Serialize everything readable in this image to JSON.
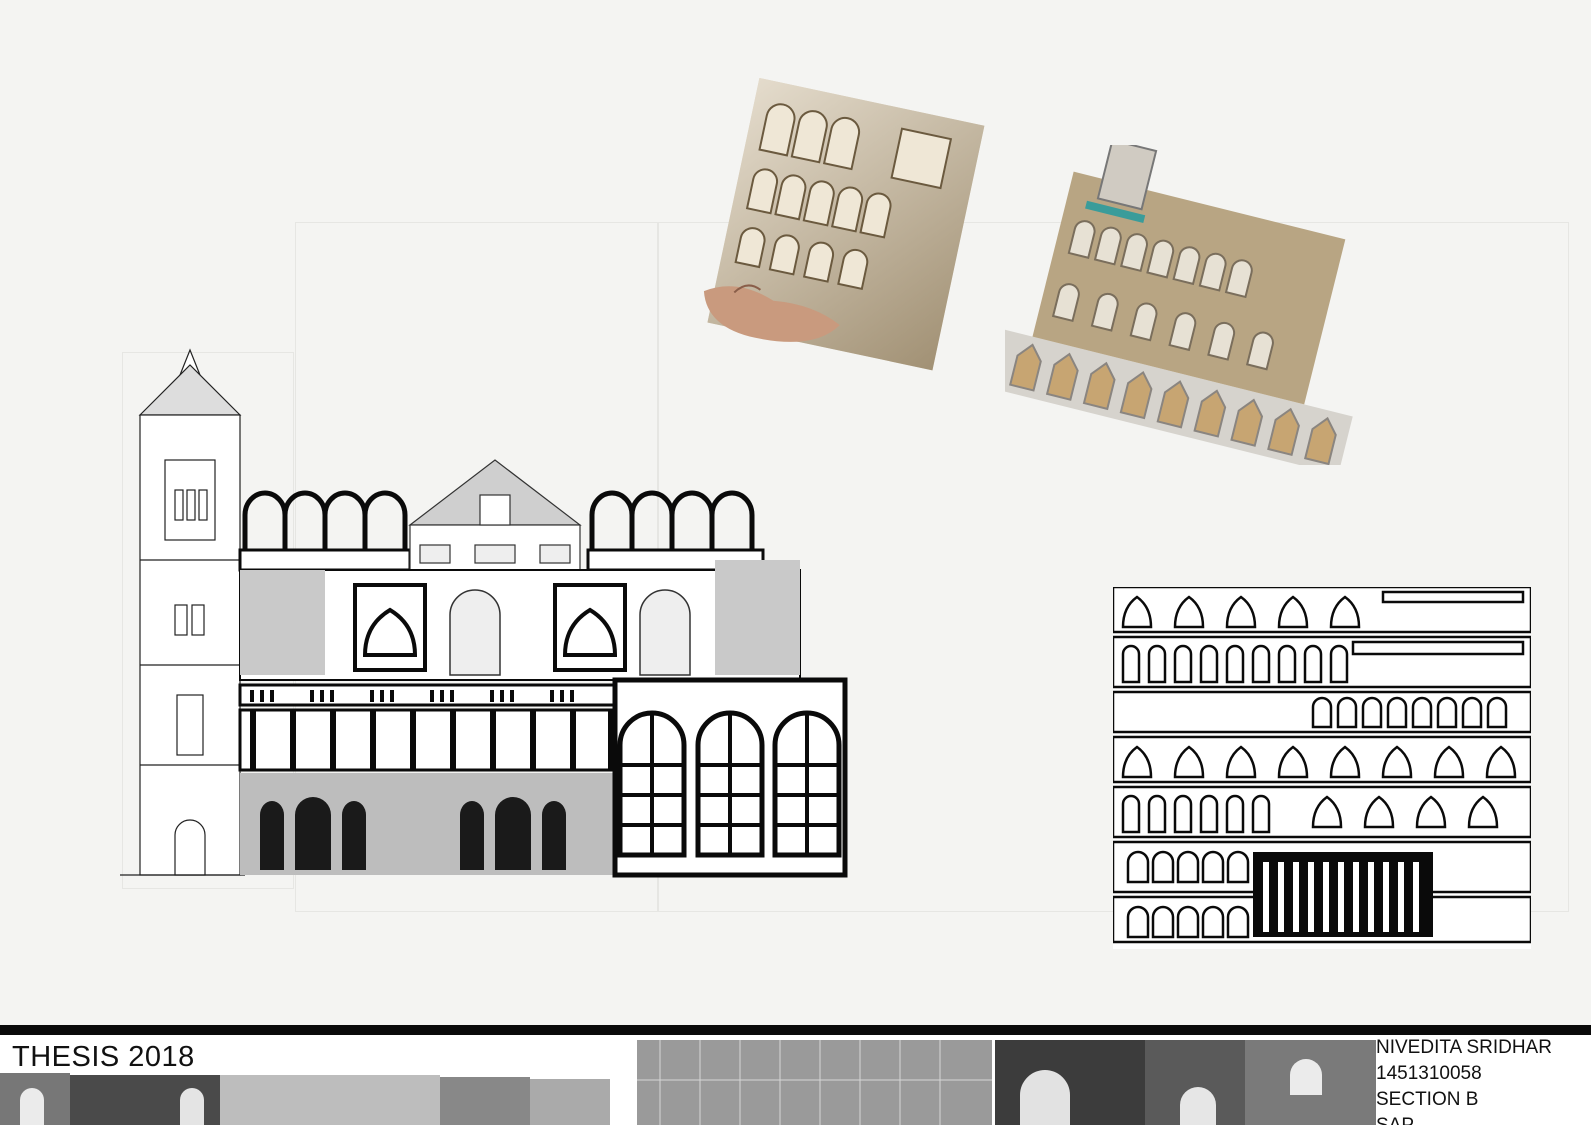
{
  "footer": {
    "title": "THESIS 2018",
    "author_name": "NIVEDITA SRIDHAR",
    "student_id": "1451310058",
    "section": "SECTION B",
    "extra_line": "SAP"
  },
  "colors": {
    "background": "#f4f4f2",
    "ink": "#0a0a0a",
    "cardboard": "#c7b595"
  }
}
